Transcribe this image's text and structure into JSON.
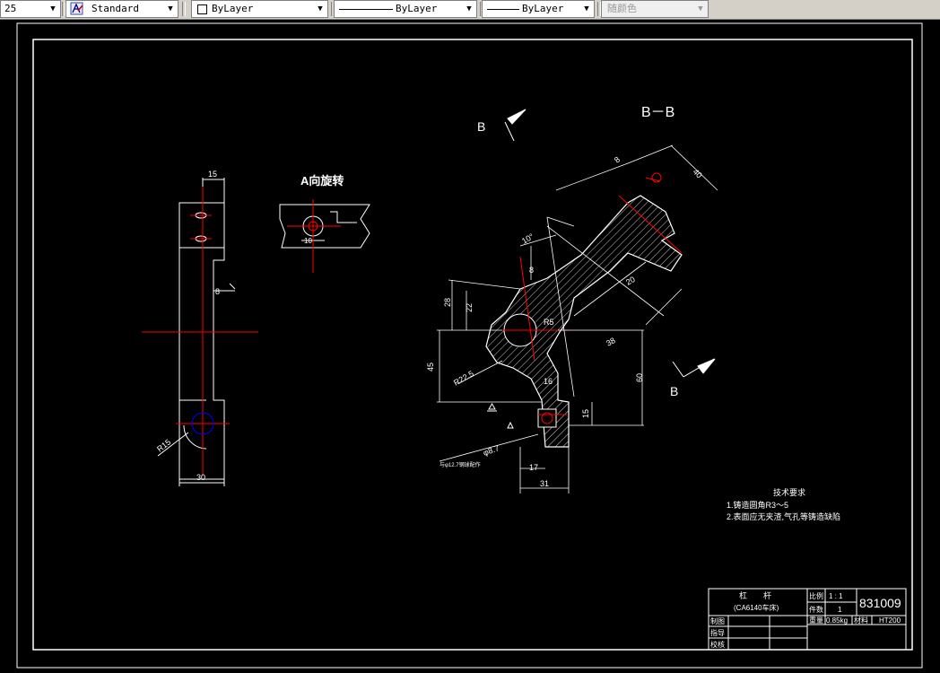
{
  "toolbar": {
    "lineweight_partial": "25",
    "text_style": "Standard",
    "layer_control": "ByLayer",
    "linetype": "ByLayer",
    "lineweight": "ByLayer",
    "plot_style": "随颜色",
    "dropdown_glyph": "▼"
  },
  "drawing": {
    "section_label": "B－B",
    "cut_marker_label": "B",
    "rotated_view_title": "A向旋转",
    "tech_title": "技术要求",
    "tech_req_1": "1.铸造圆角R3～5",
    "tech_req_2": "2.表面应无夹渣,气孔等铸造缺陷",
    "casting_note": "与φ12.7钢球配作",
    "dims": {
      "top_width": "15",
      "side_offset": "8",
      "bottom_width": "30",
      "bottom_radius": "R15",
      "rot_dia": "10",
      "d_17": "17",
      "d_31": "31",
      "d_45": "45",
      "d_60": "60",
      "d_15": "15",
      "d_r225": "R22.5",
      "d_28": "28",
      "d_22": "22",
      "d_10deg": "10°",
      "d_8a": "8",
      "d_8b": "8",
      "d_40": "40",
      "d_38": "38",
      "d_16": "16",
      "d_20": "20",
      "d_r5": "R5",
      "d_dia": "φ8.7"
    }
  },
  "title_block": {
    "part_name": "杠　　杆",
    "machine": "(CA6140车床)",
    "scale_label": "比例",
    "scale_value": "1 : 1",
    "qty_label": "件数",
    "qty_value": "1",
    "drawing_number": "831009",
    "drawn_label": "制图",
    "checked_label": "指导",
    "reviewed_label": "校核",
    "weight_label": "重量",
    "weight_value": "0.85kg",
    "material_label": "材料",
    "material_value": "HT200"
  },
  "colors": {
    "background": "#000000",
    "geometry": "#ffffff",
    "centerline": "#ff0000",
    "circle": "#0000ff",
    "toolbar": "#d4d0c8"
  }
}
